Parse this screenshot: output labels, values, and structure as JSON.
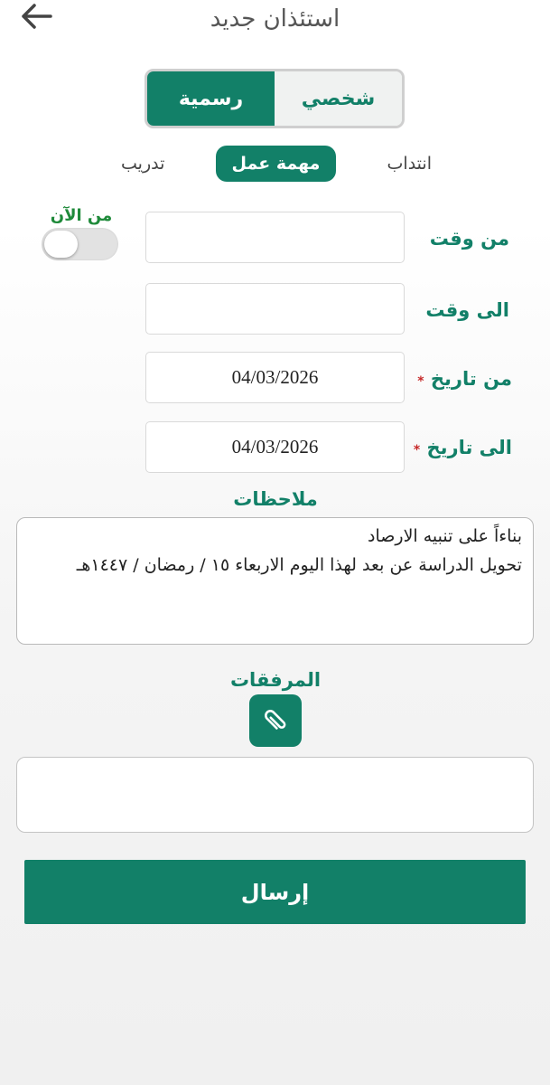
{
  "header": {
    "title": "استئذان جديد",
    "back_icon": "arrow-left-icon"
  },
  "type_toggle": {
    "options": [
      "شخصي",
      "رسمية"
    ],
    "selected": "رسمية"
  },
  "categories": {
    "items": [
      "انتداب",
      "مهمة عمل",
      "تدريب"
    ],
    "selected": "مهمة عمل"
  },
  "from_now": {
    "label": "من الآن",
    "on": false
  },
  "form": {
    "from_time": {
      "label": "من وقت",
      "value": ""
    },
    "to_time": {
      "label": "الى وقت",
      "value": ""
    },
    "from_date": {
      "label": "من تاريخ",
      "value": "04/03/2026",
      "required_mark": "*"
    },
    "to_date": {
      "label": "الى تاريخ",
      "value": "04/03/2026",
      "required_mark": "*"
    }
  },
  "notes": {
    "label": "ملاحظات",
    "value": "بناءاً على تنبيه الارصاد\nتحويل الدراسة عن بعد لهذا اليوم الاربعاء ١٥ / رمضان / ١٤٤٧هـ"
  },
  "attachments": {
    "label": "المرفقات",
    "icon": "paperclip-icon"
  },
  "submit": {
    "label": "إرسال"
  },
  "colors": {
    "primary": "#128068",
    "accent_green": "#1f8a3a",
    "required": "#c62828"
  }
}
